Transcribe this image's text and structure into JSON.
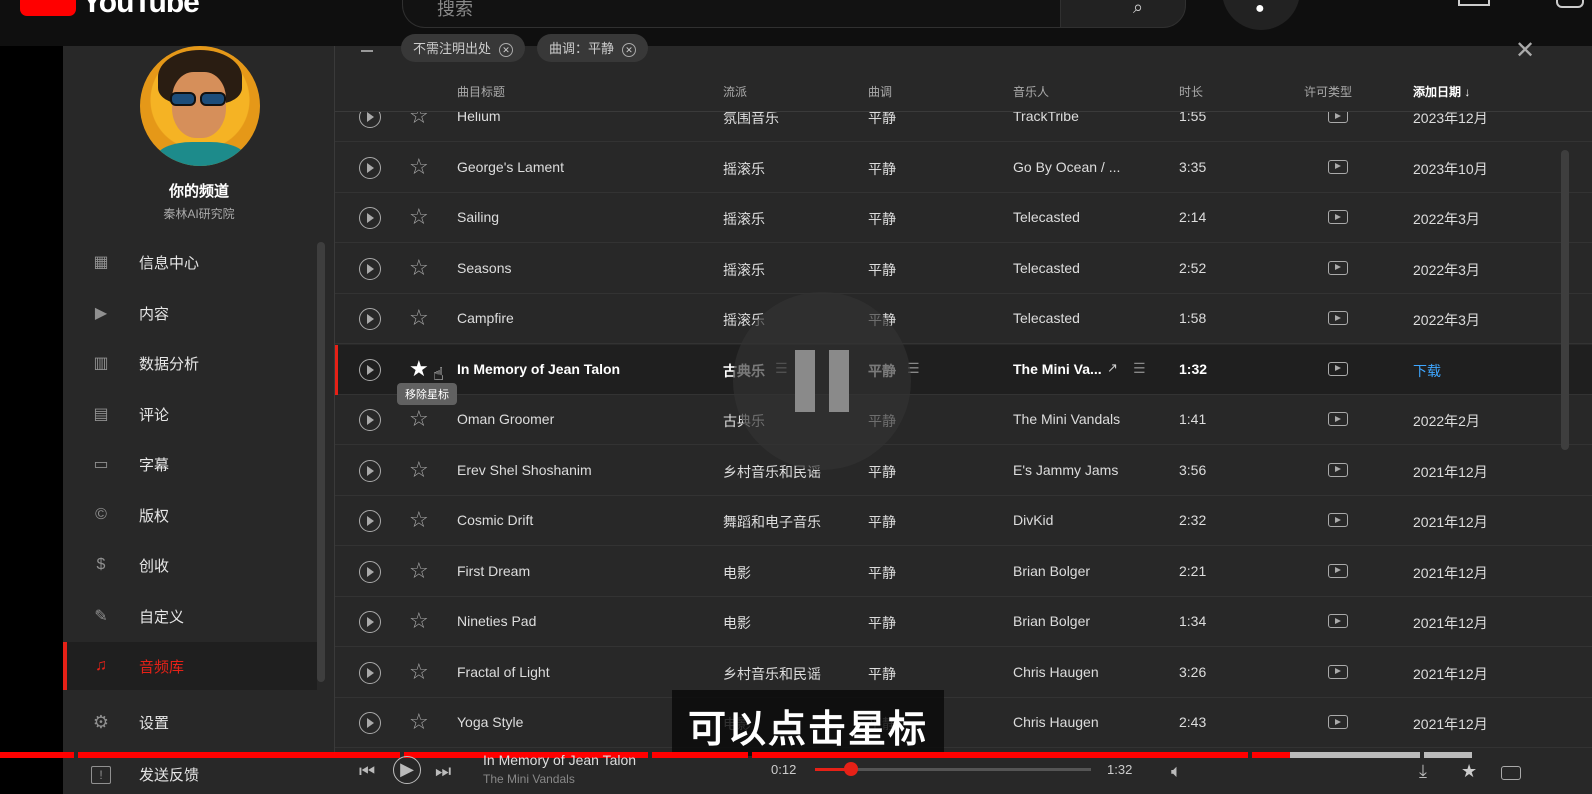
{
  "youtube": {
    "logo_text": "YouTube",
    "search_placeholder": "搜索"
  },
  "sidebar": {
    "channel_name": "你的频道",
    "channel_sub": "秦林AI研究院",
    "items": [
      {
        "label": "信息中心",
        "icon": "dashboard-icon",
        "glyph": "▦"
      },
      {
        "label": "内容",
        "icon": "content-icon",
        "glyph": "▶"
      },
      {
        "label": "数据分析",
        "icon": "analytics-icon",
        "glyph": "▥"
      },
      {
        "label": "评论",
        "icon": "comments-icon",
        "glyph": "▤"
      },
      {
        "label": "字幕",
        "icon": "subtitles-icon",
        "glyph": "▭"
      },
      {
        "label": "版权",
        "icon": "copyright-icon",
        "glyph": "©"
      },
      {
        "label": "创收",
        "icon": "monetization-icon",
        "glyph": "$"
      },
      {
        "label": "自定义",
        "icon": "customization-icon",
        "glyph": "✎"
      },
      {
        "label": "音频库",
        "icon": "audio-library-icon",
        "glyph": "♫"
      }
    ],
    "settings_label": "设置",
    "feedback_label": "发送反馈"
  },
  "filters": {
    "chips": [
      "不需注明出处",
      "曲调：平静"
    ]
  },
  "table": {
    "headers": {
      "title": "曲目标题",
      "genre": "流派",
      "mood": "曲调",
      "artist": "音乐人",
      "duration": "时长",
      "license": "许可类型",
      "date_added": "添加日期 ↓"
    },
    "rows": [
      {
        "title": "Helium",
        "genre": "氛围音乐",
        "mood": "平静",
        "artist": "TrackTribe",
        "duration": "1:55",
        "date": "2023年12月"
      },
      {
        "title": "George's Lament",
        "genre": "摇滚乐",
        "mood": "平静",
        "artist": "Go By Ocean / ...",
        "duration": "3:35",
        "date": "2023年10月"
      },
      {
        "title": "Sailing",
        "genre": "摇滚乐",
        "mood": "平静",
        "artist": "Telecasted",
        "duration": "2:14",
        "date": "2022年3月"
      },
      {
        "title": "Seasons",
        "genre": "摇滚乐",
        "mood": "平静",
        "artist": "Telecasted",
        "duration": "2:52",
        "date": "2022年3月"
      },
      {
        "title": "Campfire",
        "genre": "摇滚乐",
        "mood": "平静",
        "artist": "Telecasted",
        "duration": "1:58",
        "date": "2022年3月"
      },
      {
        "title": "In Memory of Jean Talon",
        "genre": "古典乐",
        "mood": "平静",
        "artist": "The Mini Va...",
        "duration": "1:32",
        "date": "下载",
        "playing": true
      },
      {
        "title": "Oman Groomer",
        "genre": "古典乐",
        "mood": "平静",
        "artist": "The Mini Vandals",
        "duration": "1:41",
        "date": "2022年2月"
      },
      {
        "title": "Erev Shel Shoshanim",
        "genre": "乡村音乐和民谣",
        "mood": "平静",
        "artist": "E's Jammy Jams",
        "duration": "3:56",
        "date": "2021年12月"
      },
      {
        "title": "Cosmic Drift",
        "genre": "舞蹈和电子音乐",
        "mood": "平静",
        "artist": "DivKid",
        "duration": "2:32",
        "date": "2021年12月"
      },
      {
        "title": "First Dream",
        "genre": "电影",
        "mood": "平静",
        "artist": "Brian Bolger",
        "duration": "2:21",
        "date": "2021年12月"
      },
      {
        "title": "Nineties Pad",
        "genre": "电影",
        "mood": "平静",
        "artist": "Brian Bolger",
        "duration": "1:34",
        "date": "2021年12月"
      },
      {
        "title": "Fractal of Light",
        "genre": "乡村音乐和民谣",
        "mood": "平静",
        "artist": "Chris Haugen",
        "duration": "3:26",
        "date": "2021年12月"
      },
      {
        "title": "Yoga Style",
        "genre": "电影",
        "mood": "平静",
        "artist": "Chris Haugen",
        "duration": "2:43",
        "date": "2021年12月"
      }
    ],
    "tooltip": "移除星标"
  },
  "caption": "可以点击星标",
  "player": {
    "title": "In Memory of Jean Talon",
    "artist": "The Mini Vandals",
    "current_time": "0:12",
    "total_time": "1:32",
    "progress": 0.13
  },
  "colors": {
    "accent": "#e62117",
    "link": "#3ea6ff",
    "background": "#282828"
  }
}
